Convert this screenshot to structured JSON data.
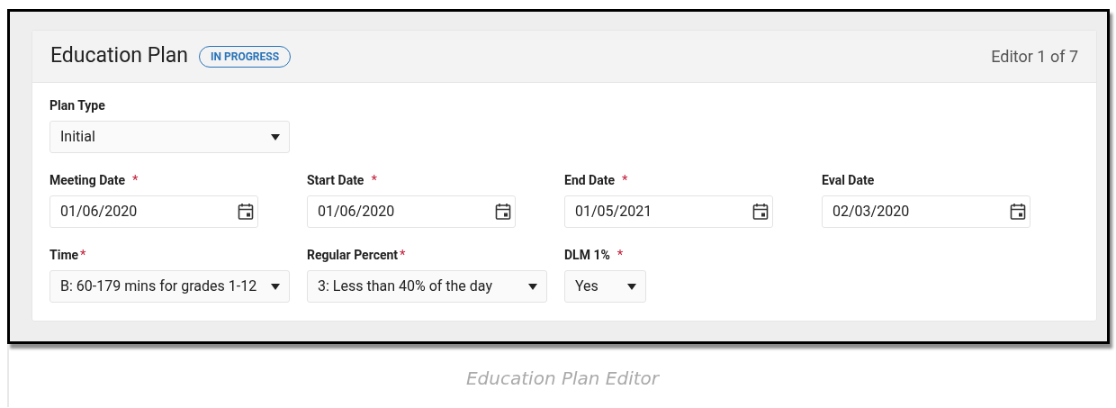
{
  "header": {
    "title": "Education Plan",
    "status": "IN PROGRESS",
    "editor_count": "Editor 1 of 7"
  },
  "rows": [
    [
      {
        "kind": "select",
        "label": "Plan Type",
        "value": "Initial"
      }
    ],
    [
      {
        "kind": "date",
        "label": "Meeting Date",
        "required_mark": "*",
        "value": "01/06/2020"
      },
      {
        "kind": "date",
        "label": "Start Date",
        "required_mark": "*",
        "value": "01/06/2020"
      },
      {
        "kind": "date",
        "label": "End Date",
        "required_mark": "*",
        "value": "01/05/2021"
      },
      {
        "kind": "date",
        "label": "Eval Date",
        "value": "02/03/2020"
      }
    ],
    [
      {
        "kind": "select",
        "label": "Time",
        "required_mark": "*",
        "value": "B: 60-179 mins for grades 1-12"
      },
      {
        "kind": "select",
        "label": "Regular Percent",
        "required_mark": "*",
        "value": "3: Less than 40% of the day"
      },
      {
        "kind": "short_select",
        "label": "DLM 1%",
        "required_mark": "*",
        "value": "Yes"
      }
    ]
  ],
  "caption": "Education Plan Editor"
}
